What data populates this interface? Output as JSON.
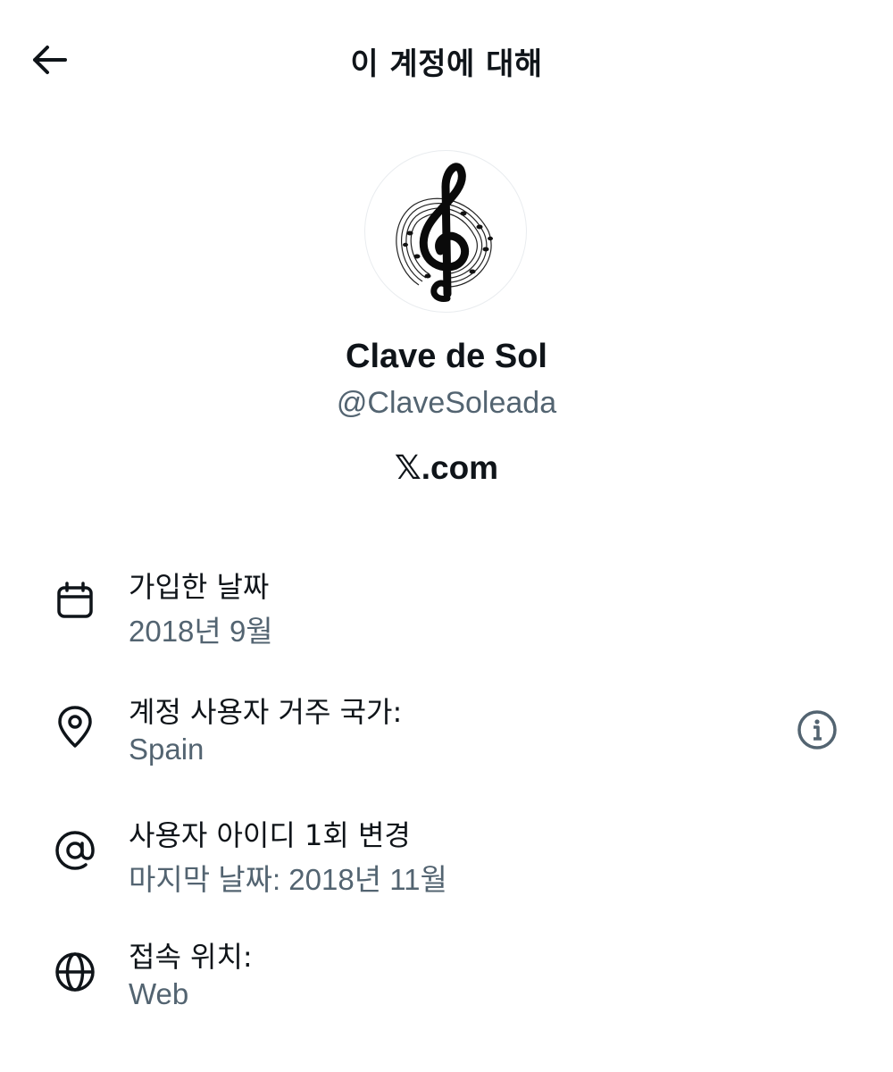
{
  "header": {
    "title": "이 계정에 대해",
    "back_icon": "arrow-left-icon"
  },
  "profile": {
    "display_name": "Clave de Sol",
    "handle": "@ClaveSoleada",
    "avatar_icon": "treble-clef-icon",
    "platform_mark": "𝕏",
    "platform_suffix": ".com"
  },
  "details": {
    "joined": {
      "icon": "calendar-icon",
      "label": "가입한 날짜",
      "value": "2018년 9월"
    },
    "country": {
      "icon": "location-pin-icon",
      "label": "계정 사용자 거주 국가:",
      "value": "Spain",
      "info_icon": "info-icon"
    },
    "username_change": {
      "icon": "at-sign-icon",
      "label": "사용자 아이디 1회 변경",
      "value": "마지막 날짜: 2018년 11월"
    },
    "connected_via": {
      "icon": "globe-icon",
      "label": "접속 위치:",
      "value": "Web"
    }
  },
  "colors": {
    "primary_text": "#0f1419",
    "secondary_text": "#536471",
    "background": "#ffffff"
  }
}
